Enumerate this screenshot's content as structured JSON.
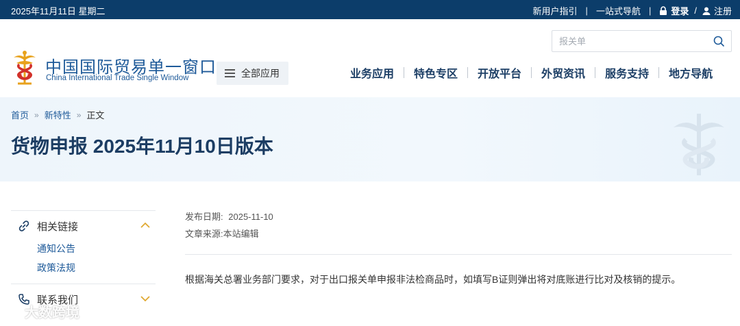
{
  "topbar": {
    "date": "2025年11月11日 星期二",
    "guide": "新用户指引",
    "nav_one_stop": "一站式导航",
    "separator": "|",
    "login": "登录",
    "slash": "/",
    "register": "注册"
  },
  "brand": {
    "name_cn": "中国国际贸易单一窗口",
    "name_en": "China International Trade Single Window"
  },
  "header": {
    "all_apps": "全部应用",
    "search_placeholder": "报关单",
    "nav": [
      "业务应用",
      "特色专区",
      "开放平台",
      "外贸资讯",
      "服务支持",
      "地方导航"
    ]
  },
  "breadcrumb": {
    "home": "首页",
    "arrow": "»",
    "section": "新特性",
    "current": "正文"
  },
  "article": {
    "title": "货物申报 2025年11月10日版本",
    "publish_label": "发布日期:",
    "publish_date": "2025-11-10",
    "source_label": "文章来源:",
    "source": "本站编辑",
    "body": "根据海关总署业务部门要求，对于出口报关单申报非法检商品时，如填写B证则弹出将对底账进行比对及核销的提示。"
  },
  "sidebar": {
    "related_links": "相关链接",
    "links": [
      "通知公告",
      "政策法规"
    ],
    "contact": "联系我们"
  },
  "watermark": "大数跨境",
  "colors": {
    "topbar_bg": "#0c3d6a",
    "brand_blue": "#1e5a99",
    "nav_text": "#1d3f66",
    "logo_gold": "#e8a21c",
    "logo_red": "#d2312a",
    "chevron": "#e0a830"
  }
}
